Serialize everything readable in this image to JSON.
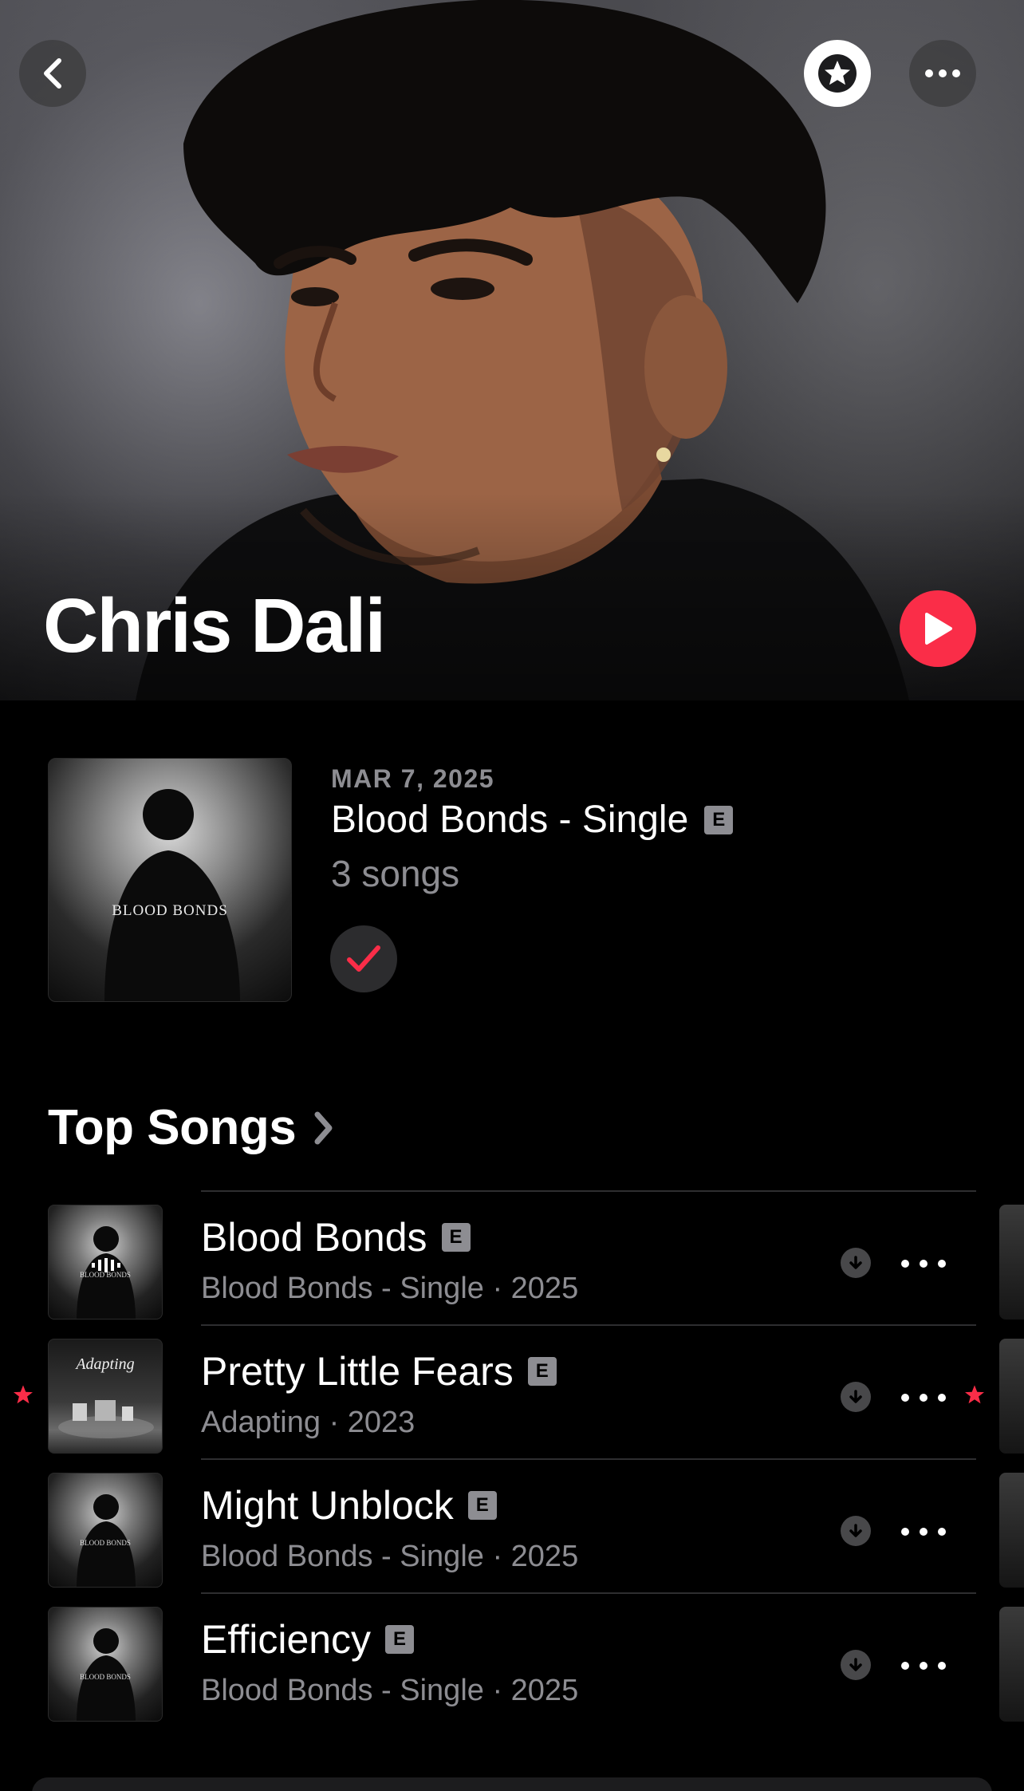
{
  "header": {
    "artist_name": "Chris Dali"
  },
  "latest_release": {
    "date": "MAR 7, 2025",
    "title": "Blood Bonds - Single",
    "explicit": "E",
    "count": "3 songs",
    "art_text": "BLOOD BONDS"
  },
  "top_songs": {
    "title": "Top Songs",
    "songs": [
      {
        "title": "Blood Bonds",
        "explicit": "E",
        "subtitle": "Blood Bonds - Single · 2025",
        "art_text": "BLOOD BONDS",
        "favorite": false
      },
      {
        "title": "Pretty Little Fears",
        "explicit": "E",
        "subtitle": "Adapting · 2023",
        "art_text": "Adapting",
        "favorite": true
      },
      {
        "title": "Might Unblock",
        "explicit": "E",
        "subtitle": "Blood Bonds - Single · 2025",
        "art_text": "BLOOD BONDS",
        "favorite": false
      },
      {
        "title": "Efficiency",
        "explicit": "E",
        "subtitle": "Blood Bonds - Single · 2025",
        "art_text": "BLOOD BONDS",
        "favorite": false
      }
    ]
  },
  "colors": {
    "accent": "#fa2d48",
    "secondary_text": "#8d8d92",
    "background": "#000000"
  },
  "icons": {
    "back": "chevron-left-icon",
    "star": "star-icon",
    "more": "ellipsis-icon",
    "play": "play-icon",
    "added": "checkmark-icon",
    "download": "download-icon"
  }
}
